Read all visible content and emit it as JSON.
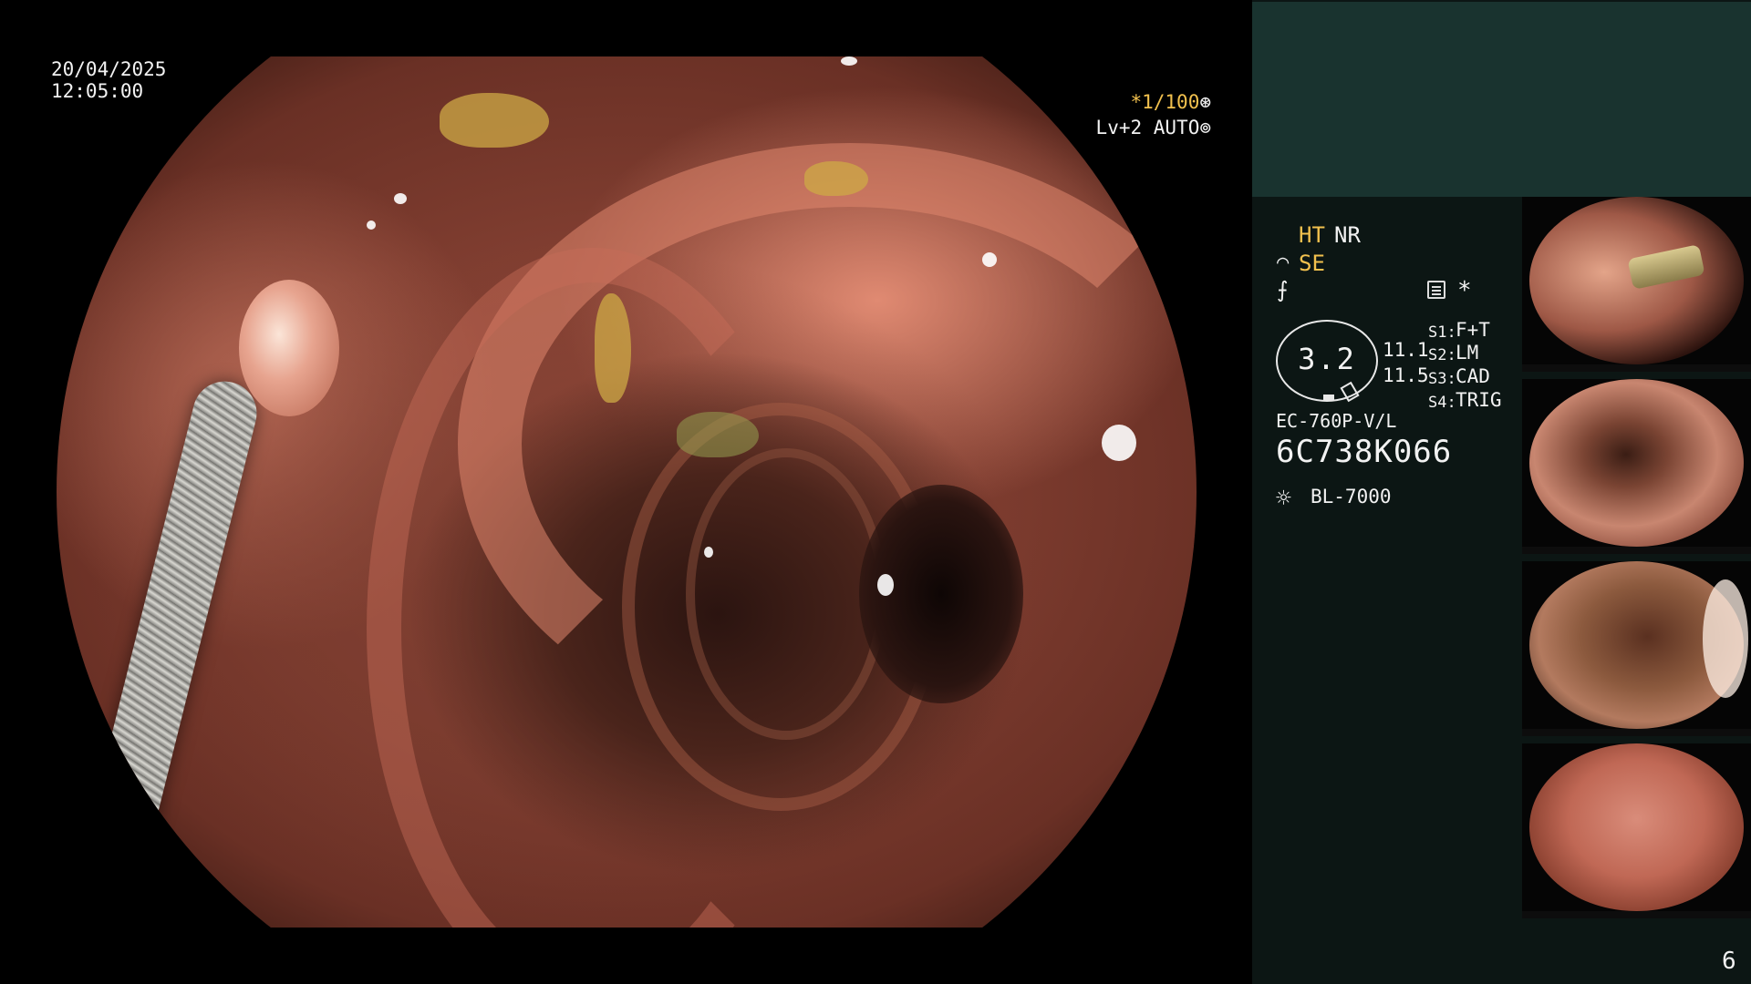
{
  "overlay": {
    "date": "20/04/2025",
    "time": "12:05:00",
    "shutter_value": "*1/100",
    "shutter_icon_glyph": "⊛",
    "iris_value": "Lv+2 AUTO",
    "iris_icon_glyph": "⊚"
  },
  "panel": {
    "modes": {
      "ht": "HT",
      "nr": "NR",
      "se_icon_glyph": "⌒",
      "se": "SE",
      "wave_icon_glyph": "⨍",
      "asterisk": "*"
    },
    "oval_value": "3.2",
    "readings": [
      "11.1",
      "11.5"
    ],
    "switches": [
      {
        "key": "S1:",
        "value": "F+T"
      },
      {
        "key": "S2:",
        "value": "LM"
      },
      {
        "key": "S3:",
        "value": "CAD"
      },
      {
        "key": "S4:",
        "value": "TRIG"
      }
    ],
    "scope_model": "EC-760P-V/L",
    "scope_serial": "6C738K066",
    "light_icon_glyph": "☼",
    "light_source": "BL-7000",
    "page_number": "6"
  },
  "colors": {
    "accent_yellow": "#f2c14e",
    "panel_top": "#19332f",
    "panel_bg": "#0c1614",
    "text": "#f2f2f2"
  },
  "icons": [
    "shutter-icon",
    "iris-icon",
    "se-icon",
    "wave-icon",
    "record-icon",
    "light-source-icon"
  ]
}
